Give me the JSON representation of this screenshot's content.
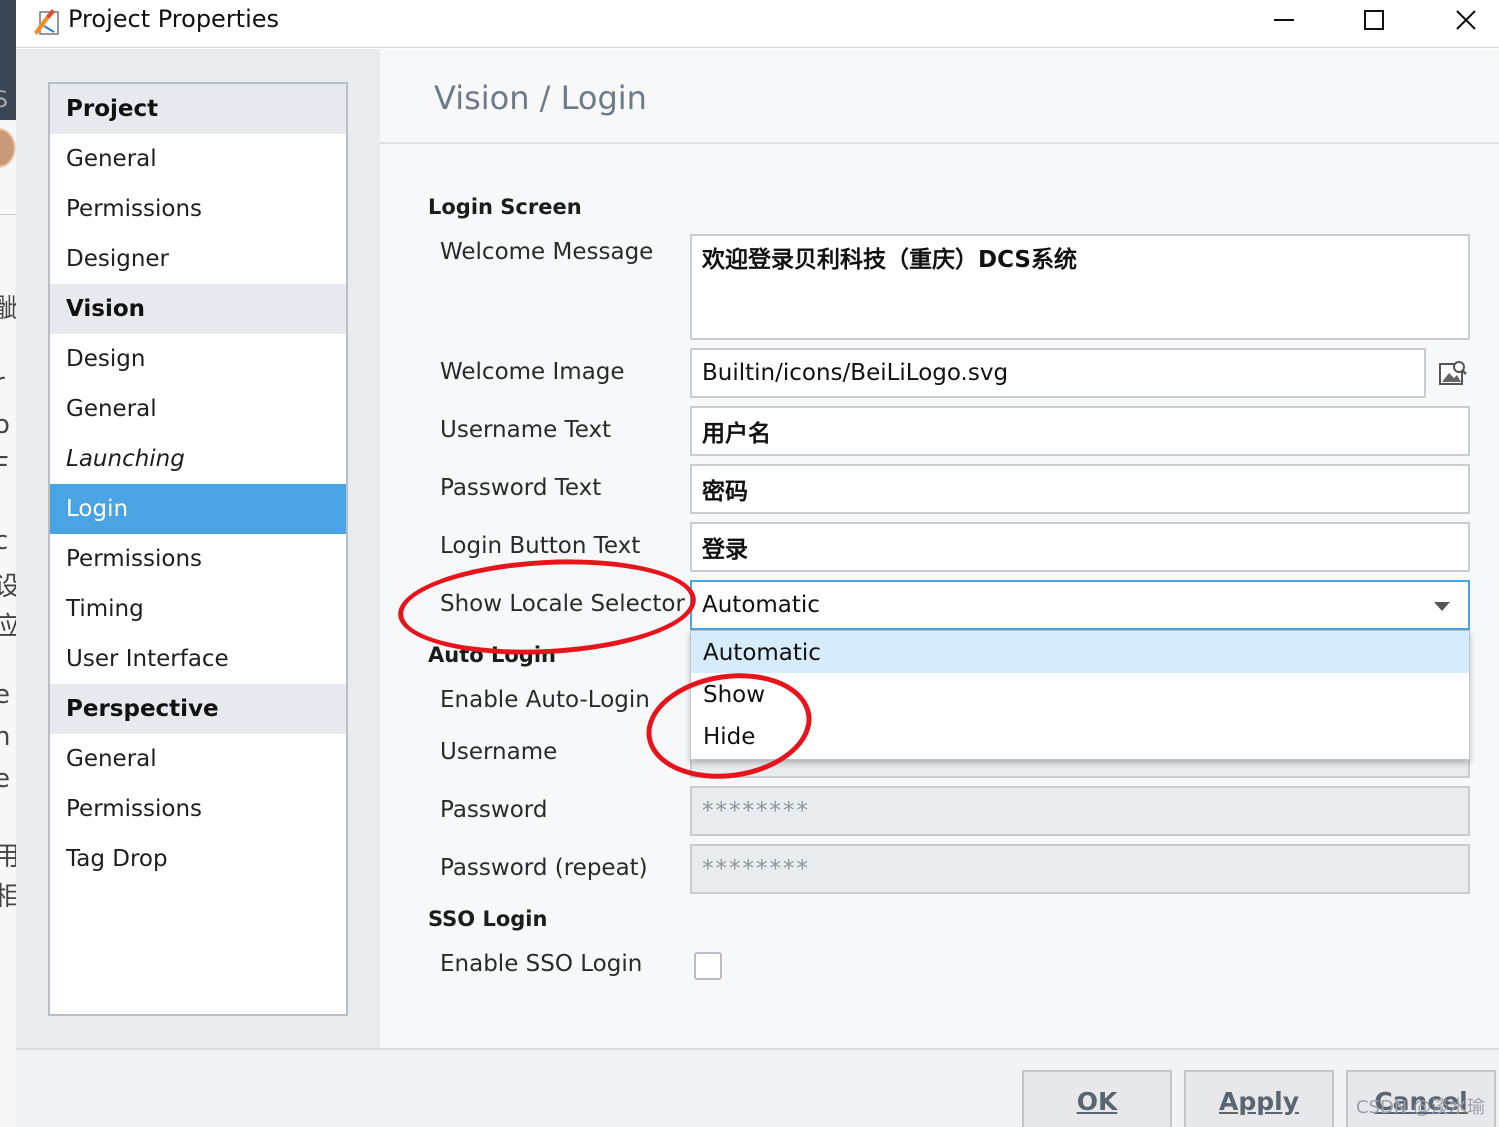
{
  "window": {
    "title": "Project Properties",
    "icons": {
      "app": "project-properties-icon",
      "minimize": "minimize-icon",
      "maximize": "maximize-icon",
      "close": "close-icon"
    }
  },
  "background_fragments": [
    "S",
    "骴",
    "r",
    "o",
    "F",
    "c",
    "设",
    "应",
    "e",
    "n",
    "e",
    "用",
    "相"
  ],
  "nav": {
    "groups": [
      {
        "header": "Project",
        "items": [
          "General",
          "Permissions",
          "Designer"
        ]
      },
      {
        "header": "Vision",
        "items": [
          "Design",
          "General",
          "Launching",
          "Login",
          "Permissions",
          "Timing",
          "User Interface"
        ]
      },
      {
        "header": "Perspective",
        "items": [
          "General",
          "Permissions",
          "Tag Drop"
        ]
      }
    ],
    "selected": "Vision / Login",
    "italic_item": "Launching",
    "selected_color": "#4aa3e3"
  },
  "page": {
    "title": "Vision / Login"
  },
  "login_screen": {
    "section_title": "Login Screen",
    "welcome_message": {
      "label": "Welcome Message",
      "value": "欢迎登录贝利科技（重庆）DCS系统"
    },
    "welcome_image": {
      "label": "Welcome Image",
      "value": "Builtin/icons/BeiLiLogo.svg",
      "browse_icon": "image-browse-icon"
    },
    "username_text": {
      "label": "Username Text",
      "value": "用户名"
    },
    "password_text": {
      "label": "Password Text",
      "value": "密码"
    },
    "login_button_text": {
      "label": "Login Button Text",
      "value": "登录"
    },
    "show_locale_selector": {
      "label": "Show Locale Selector",
      "value": "Automatic",
      "options": [
        "Automatic",
        "Show",
        "Hide"
      ],
      "highlighted": "Automatic"
    }
  },
  "auto_login": {
    "section_title": "Auto Login",
    "enable_label": "Enable Auto-Login",
    "username": {
      "label": "Username",
      "value": ""
    },
    "password": {
      "label": "Password",
      "value": "********"
    },
    "password_repeat": {
      "label": "Password (repeat)",
      "value": "********"
    }
  },
  "sso_login": {
    "section_title": "SSO Login",
    "enable_label": "Enable SSO Login",
    "checked": false
  },
  "footer": {
    "ok": "OK",
    "apply": "Apply",
    "cancel": "Cancel",
    "watermark": "CSDN @淡水瑜"
  },
  "colors": {
    "accent": "#4aa3e3",
    "annotation": "#e8141c",
    "dropdown_highlight": "#d6ecfb"
  }
}
